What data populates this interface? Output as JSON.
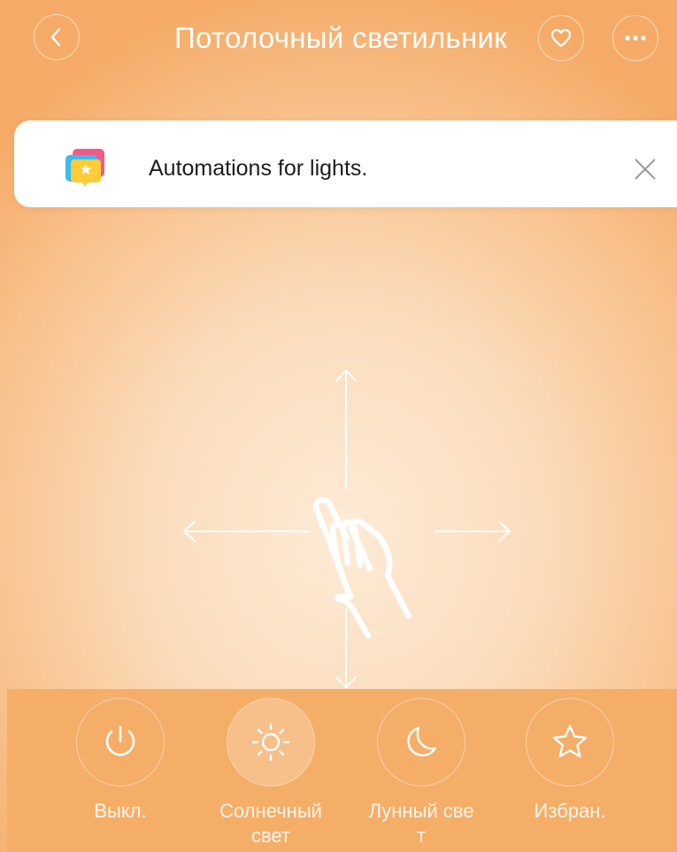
{
  "header": {
    "title": "Потолочный светильник",
    "back_icon": "chevron-left-icon",
    "favorite_icon": "heart-icon",
    "more_icon": "more-dots-icon"
  },
  "banner": {
    "text": "Automations for lights.",
    "icon": "automation-cards-icon",
    "close_icon": "close-icon"
  },
  "gesture": {
    "icon": "swipe-hand-icon"
  },
  "modes": [
    {
      "label": "Выкл.",
      "icon": "power-icon",
      "active": false
    },
    {
      "label": "Солнечный свет",
      "icon": "sun-icon",
      "active": true
    },
    {
      "label": "Лунный свет",
      "icon": "moon-icon",
      "active": false
    },
    {
      "label": "Избран.",
      "icon": "star-icon",
      "active": false
    }
  ],
  "colors": {
    "background_top": "#f5ab67",
    "background_center": "#fdebd6",
    "bottom_bar": "#f5ae68",
    "banner": "#ffffff",
    "text_on_accent": "#ffffff"
  }
}
